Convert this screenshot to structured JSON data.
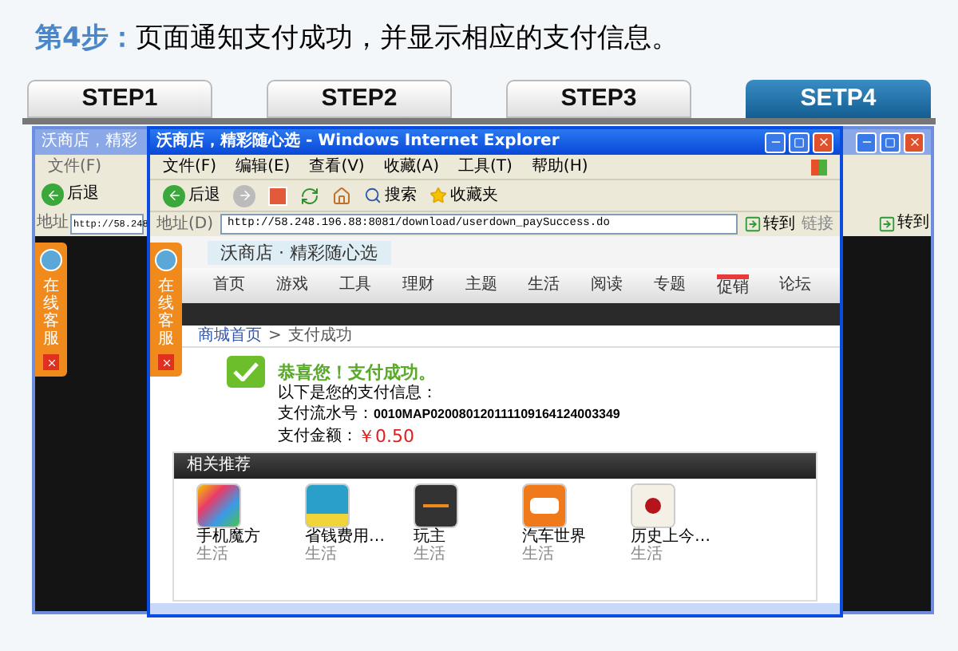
{
  "header": {
    "step": "第4步：",
    "text": "页面通知支付成功，并显示相应的支付信息。"
  },
  "steps": [
    {
      "label": "STEP1",
      "selected": false
    },
    {
      "label": "STEP2",
      "selected": false
    },
    {
      "label": "STEP3",
      "selected": false
    },
    {
      "label": "SETP4",
      "selected": true
    }
  ],
  "back_window": {
    "title": "沃商店，精彩",
    "menu": [
      "文件(F)"
    ],
    "back_label": "后退",
    "address_label": "地址",
    "url": "http://58.248",
    "go": "转到",
    "service_tab": "在线客服"
  },
  "browser": {
    "title": "沃商店，精彩随心选 - Windows Internet Explorer",
    "menu": [
      "文件(F)",
      "编辑(E)",
      "查看(V)",
      "收藏(A)",
      "工具(T)",
      "帮助(H)"
    ],
    "toolbar": {
      "back": "后退",
      "search": "搜索",
      "favorites": "收藏夹"
    },
    "address_label": "地址(D)",
    "url": "http://58.248.196.88:8081/download/userdown_paySuccess.do",
    "go": "转到",
    "links": "链接",
    "site_name": "沃商店 · 精彩随心选",
    "nav": [
      {
        "label": "首页",
        "hot": false
      },
      {
        "label": "游戏",
        "hot": false
      },
      {
        "label": "工具",
        "hot": false
      },
      {
        "label": "理财",
        "hot": false
      },
      {
        "label": "主题",
        "hot": false
      },
      {
        "label": "生活",
        "hot": false
      },
      {
        "label": "阅读",
        "hot": false
      },
      {
        "label": "专题",
        "hot": false
      },
      {
        "label": "促销",
        "hot": true
      },
      {
        "label": "论坛",
        "hot": false
      }
    ],
    "service_tab": "在线客服",
    "breadcrumb": {
      "items": [
        "商城首页",
        "支付成功"
      ],
      "separator": ">"
    },
    "success": {
      "title": "恭喜您！支付成功。",
      "intro": "以下是您的支付信息：",
      "serial_label": "支付流水号：",
      "serial": "0010MAP020080120111109164124003349",
      "amount_label": "支付金额：",
      "amount": "￥0.50"
    },
    "recommend": {
      "title": "相关推荐",
      "apps": [
        {
          "name": "手机魔方",
          "category": "生活",
          "kind": "cube"
        },
        {
          "name": "省钱费用…",
          "category": "生活",
          "kind": "scale"
        },
        {
          "name": "玩主",
          "category": "生活",
          "kind": "guide"
        },
        {
          "name": "汽车世界",
          "category": "生活",
          "kind": "car"
        },
        {
          "name": "历史上今…",
          "category": "生活",
          "kind": "letter"
        }
      ]
    }
  }
}
